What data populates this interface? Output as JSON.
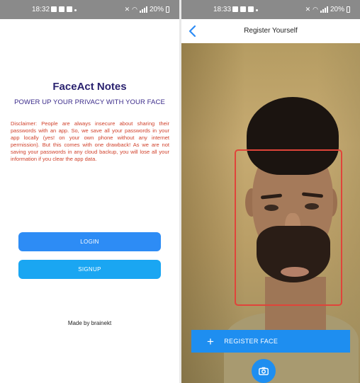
{
  "left_screen": {
    "status_time": "18:32",
    "status_battery": "20%",
    "app_title": "FaceAct Notes",
    "tagline": "POWER UP YOUR PRIVACY WITH YOUR FACE",
    "disclaimer": "Disclaimer: People are always insecure about sharing their passwords with an app. So, we save all your passwords in your app locally (yes! on your own phone without any internet permission). But this comes with one drawback! As we are not saving your passwords in any cloud backup, you will lose all your information if you clear the app data.",
    "login_label": "LOGIN",
    "signup_label": "SIGNUP",
    "made_by": "Made by brainekt"
  },
  "right_screen": {
    "status_time": "18:33",
    "status_battery": "20%",
    "appbar_title": "Register Yourself",
    "register_label": "REGISTER FACE"
  },
  "colors": {
    "primary": "#2d8cf5",
    "secondary": "#1aa6f2",
    "title": "#2b2370",
    "disclaimer": "#d0402a",
    "face_box": "#e0443a"
  },
  "icons": [
    "back-arrow-icon",
    "plus-icon",
    "camera-icon",
    "wifi-icon",
    "battery-icon",
    "signal-icon",
    "mute-icon"
  ]
}
